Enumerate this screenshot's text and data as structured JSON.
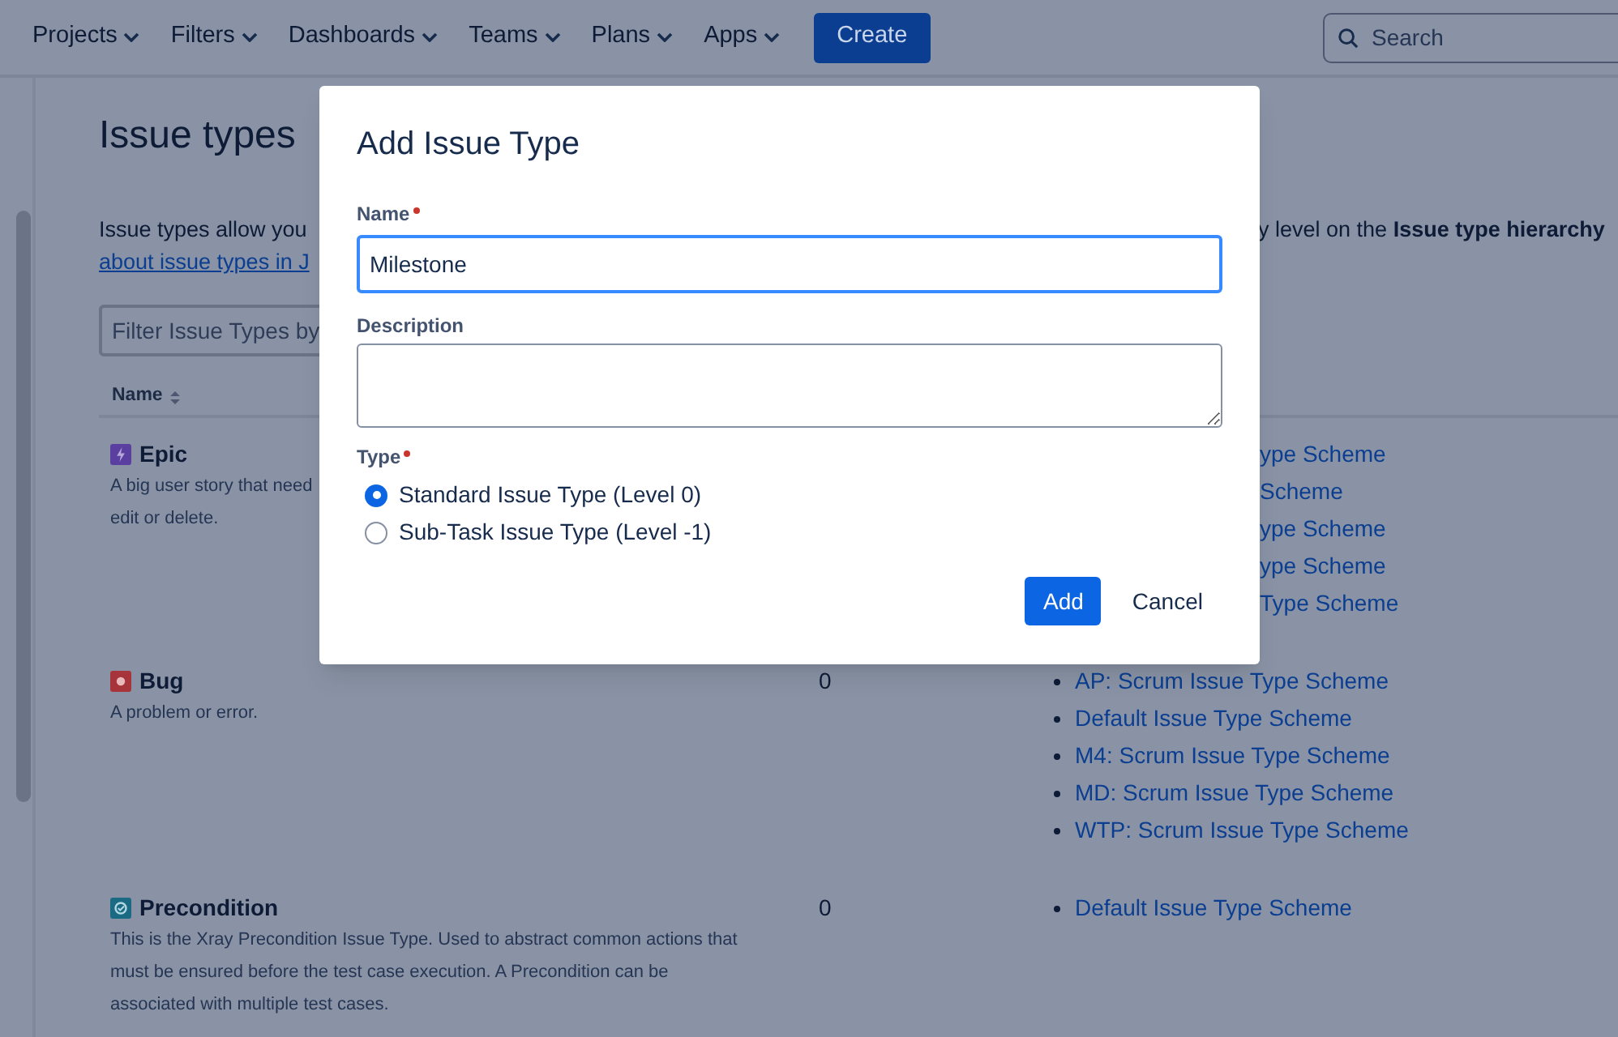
{
  "nav": {
    "items": [
      {
        "label": "Projects"
      },
      {
        "label": "Filters"
      },
      {
        "label": "Dashboards"
      },
      {
        "label": "Teams"
      },
      {
        "label": "Plans"
      },
      {
        "label": "Apps"
      }
    ],
    "create_button": "Create",
    "search": {
      "placeholder": "Search"
    }
  },
  "page": {
    "title": "Issue types",
    "intro_left": "Issue types allow you",
    "intro_right": "y level on the **Issue type hierarchy**",
    "intro_link": "about issue types in J",
    "filter": {
      "placeholder": "Filter Issue Types by"
    },
    "columns": [
      {
        "label": "Name"
      }
    ]
  },
  "rows": [
    {
      "kind": "covered",
      "name": "Epic",
      "description_lines": [
        "A big user story that need",
        "edit or delete."
      ],
      "schemes": [
        "ype Scheme",
        "Scheme",
        "ype Scheme",
        "ype Scheme",
        "Type Scheme"
      ]
    },
    {
      "kind": "full",
      "name": "Bug",
      "description_lines": [
        "A problem or error."
      ],
      "count": "0",
      "schemes": [
        "AP: Scrum Issue Type Scheme",
        "Default Issue Type Scheme",
        "M4: Scrum Issue Type Scheme",
        "MD: Scrum Issue Type Scheme",
        "WTP: Scrum Issue Type Scheme"
      ]
    },
    {
      "kind": "full",
      "name": "Precondition",
      "description_lines": [
        "This is the Xray Precondition Issue Type. Used to abstract common actions that",
        "must be ensured before the test case execution. A Precondition can be",
        "associated with multiple test cases."
      ],
      "count": "0",
      "schemes": [
        "Default Issue Type Scheme"
      ]
    }
  ],
  "modal": {
    "title": "Add Issue Type",
    "fields": [
      {
        "kind": "text",
        "label": "Name",
        "required": true,
        "value": "Milestone",
        "focused": true
      },
      {
        "kind": "textarea",
        "label": "Description",
        "required": false,
        "focused": false
      }
    ],
    "type": {
      "label": "Type",
      "required": true,
      "options": [
        {
          "label": "Standard Issue Type (Level 0)",
          "selected": true
        },
        {
          "label": "Sub-Task Issue Type (Level -1)",
          "selected": false
        }
      ]
    },
    "buttons": [
      {
        "kind": "primary",
        "label": "Add"
      },
      {
        "kind": "subtle",
        "label": "Cancel"
      }
    ]
  }
}
